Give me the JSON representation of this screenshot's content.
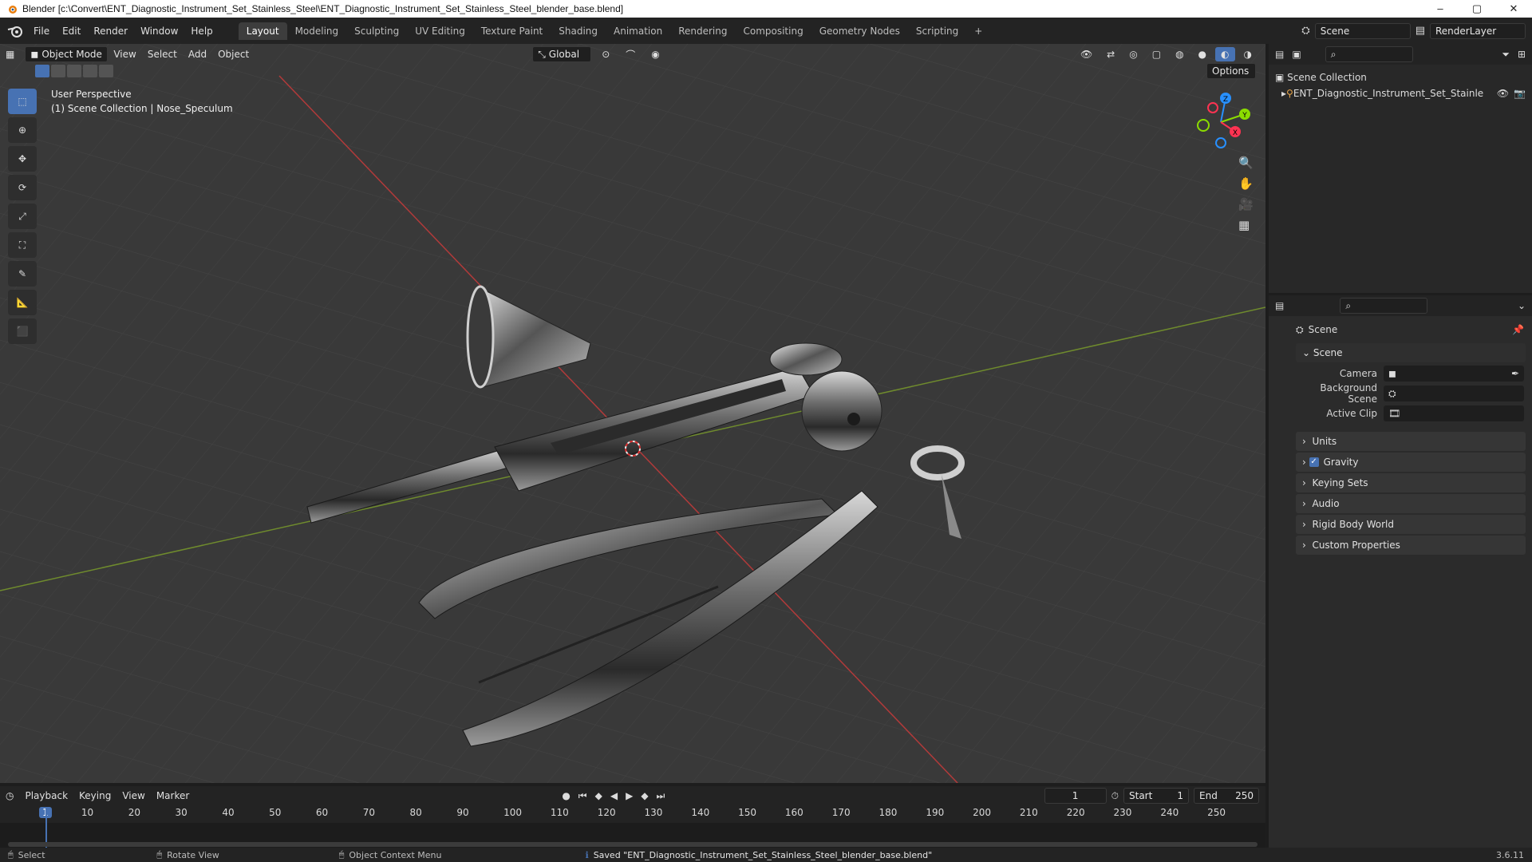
{
  "titlebar": {
    "title": "Blender [c:\\Convert\\ENT_Diagnostic_Instrument_Set_Stainless_Steel\\ENT_Diagnostic_Instrument_Set_Stainless_Steel_blender_base.blend]",
    "minimize": "–",
    "maximize": "▢",
    "close": "✕"
  },
  "menubar": {
    "menus": [
      "File",
      "Edit",
      "Render",
      "Window",
      "Help"
    ],
    "workspaces": [
      "Layout",
      "Modeling",
      "Sculpting",
      "UV Editing",
      "Texture Paint",
      "Shading",
      "Animation",
      "Rendering",
      "Compositing",
      "Geometry Nodes",
      "Scripting"
    ],
    "active_workspace": "Layout",
    "add_tab": "+",
    "scene_name": "Scene",
    "view_layer": "RenderLayer"
  },
  "viewport": {
    "mode": "Object Mode",
    "menus": [
      "View",
      "Select",
      "Add",
      "Object"
    ],
    "orientation": "Global",
    "options_label": "Options",
    "overlay_line1": "User Perspective",
    "overlay_line2": "(1) Scene Collection | Nose_Speculum",
    "gizmo_axes": {
      "x": "X",
      "y": "Y",
      "z": "Z"
    },
    "axis_colors": {
      "x": "#ff3352",
      "y": "#8bdc00",
      "z": "#2890ff"
    }
  },
  "outliner": {
    "root": "Scene Collection",
    "item": "ENT_Diagnostic_Instrument_Set_Stainle"
  },
  "properties": {
    "header": "Scene",
    "section": "Scene",
    "fields": [
      {
        "label": "Camera",
        "value": ""
      },
      {
        "label": "Background Scene",
        "value": ""
      },
      {
        "label": "Active Clip",
        "value": ""
      }
    ],
    "panels": [
      "Units",
      "Gravity",
      "Keying Sets",
      "Audio",
      "Rigid Body World",
      "Custom Properties"
    ],
    "gravity_checked": true
  },
  "timeline": {
    "menus": [
      "Playback",
      "Keying",
      "View",
      "Marker"
    ],
    "current_frame": "1",
    "start_label": "Start",
    "start": "1",
    "end_label": "End",
    "end": "250",
    "ticks": [
      "1",
      "10",
      "20",
      "30",
      "40",
      "50",
      "60",
      "70",
      "80",
      "90",
      "100",
      "110",
      "120",
      "130",
      "140",
      "150",
      "160",
      "170",
      "180",
      "190",
      "200",
      "210",
      "220",
      "230",
      "240",
      "250"
    ]
  },
  "statusbar": {
    "select": "Select",
    "rotate": "Rotate View",
    "context": "Object Context Menu",
    "message": "Saved \"ENT_Diagnostic_Instrument_Set_Stainless_Steel_blender_base.blend\"",
    "version": "3.6.11"
  }
}
